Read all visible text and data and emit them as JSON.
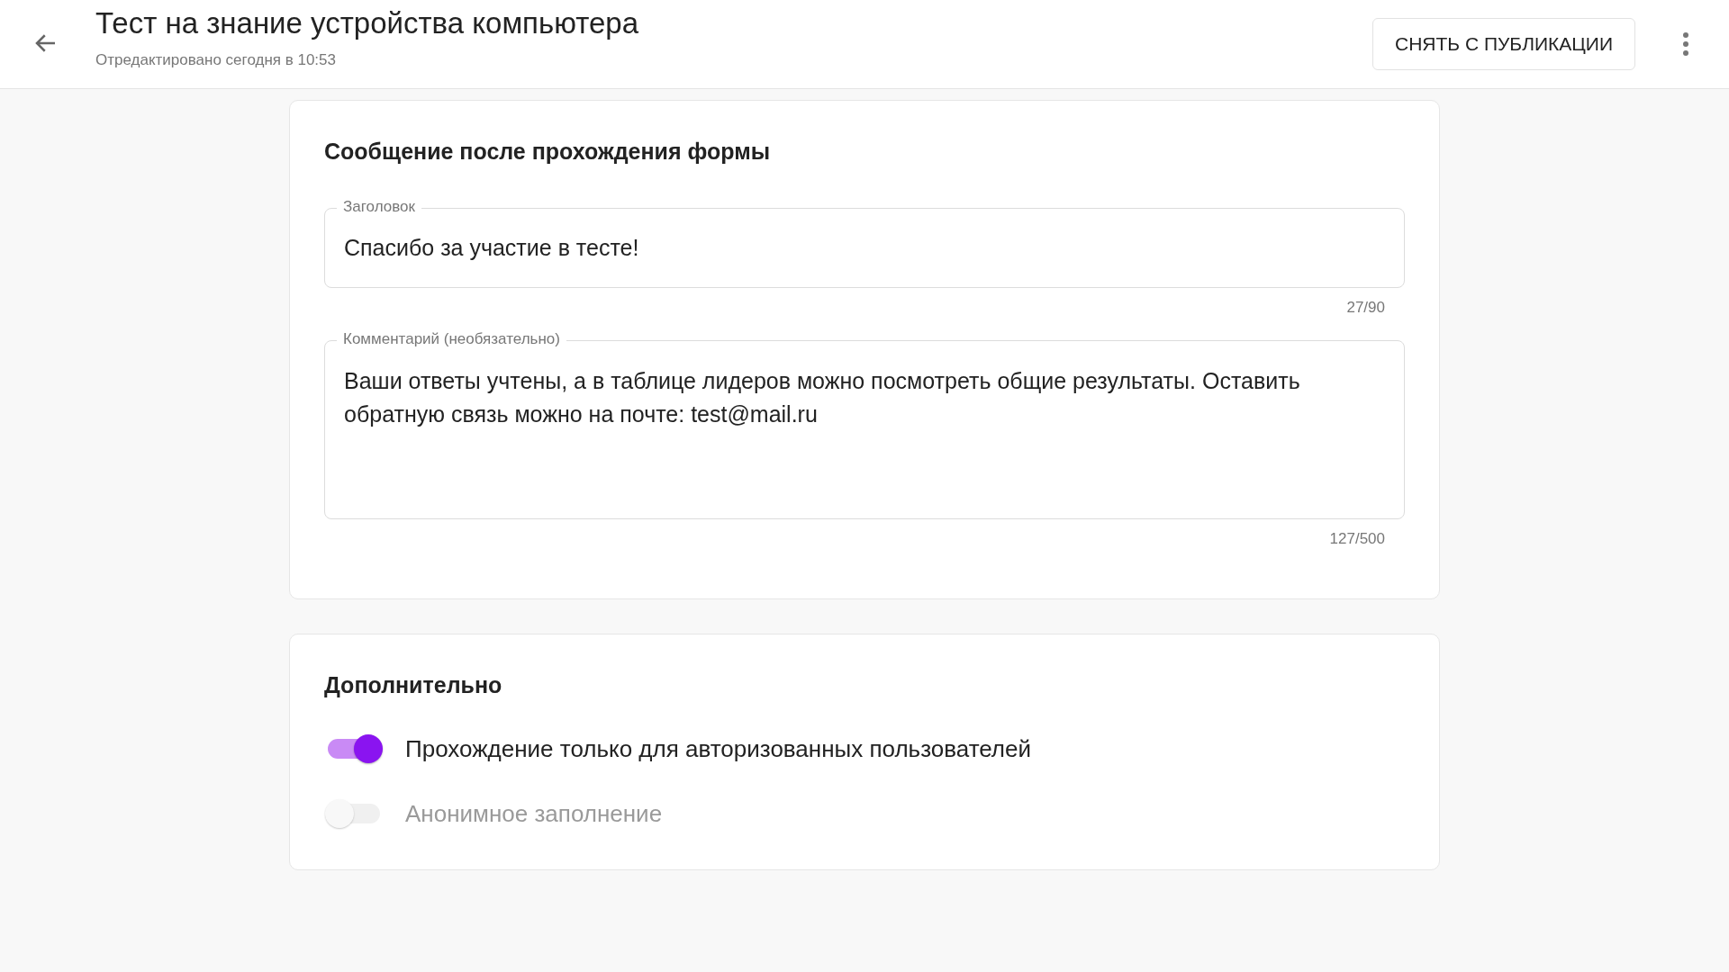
{
  "header": {
    "title": "Тест на знание устройства компьютера",
    "subtitle": "Отредактировано сегодня в 10:53",
    "action_button": "СНЯТЬ С ПУБЛИКАЦИИ"
  },
  "completion_message": {
    "heading": "Сообщение после прохождения формы",
    "fields": [
      {
        "kind": "input",
        "label": "Заголовок",
        "value": "Спасибо за участие в тесте!",
        "counter": "27/90"
      },
      {
        "kind": "textarea",
        "label": "Комментарий (необязательно)",
        "value": "Ваши ответы учтены, а в таблице лидеров можно посмотреть общие результаты. Оставить обратную связь можно на почте: test@mail.ru",
        "counter": "127/500"
      }
    ]
  },
  "additional": {
    "heading": "Дополнительно",
    "toggles": [
      {
        "label": "Прохождение только для авторизованных пользователей",
        "on": true,
        "disabled": false
      },
      {
        "label": "Анонимное заполнение",
        "on": false,
        "disabled": true
      }
    ]
  }
}
